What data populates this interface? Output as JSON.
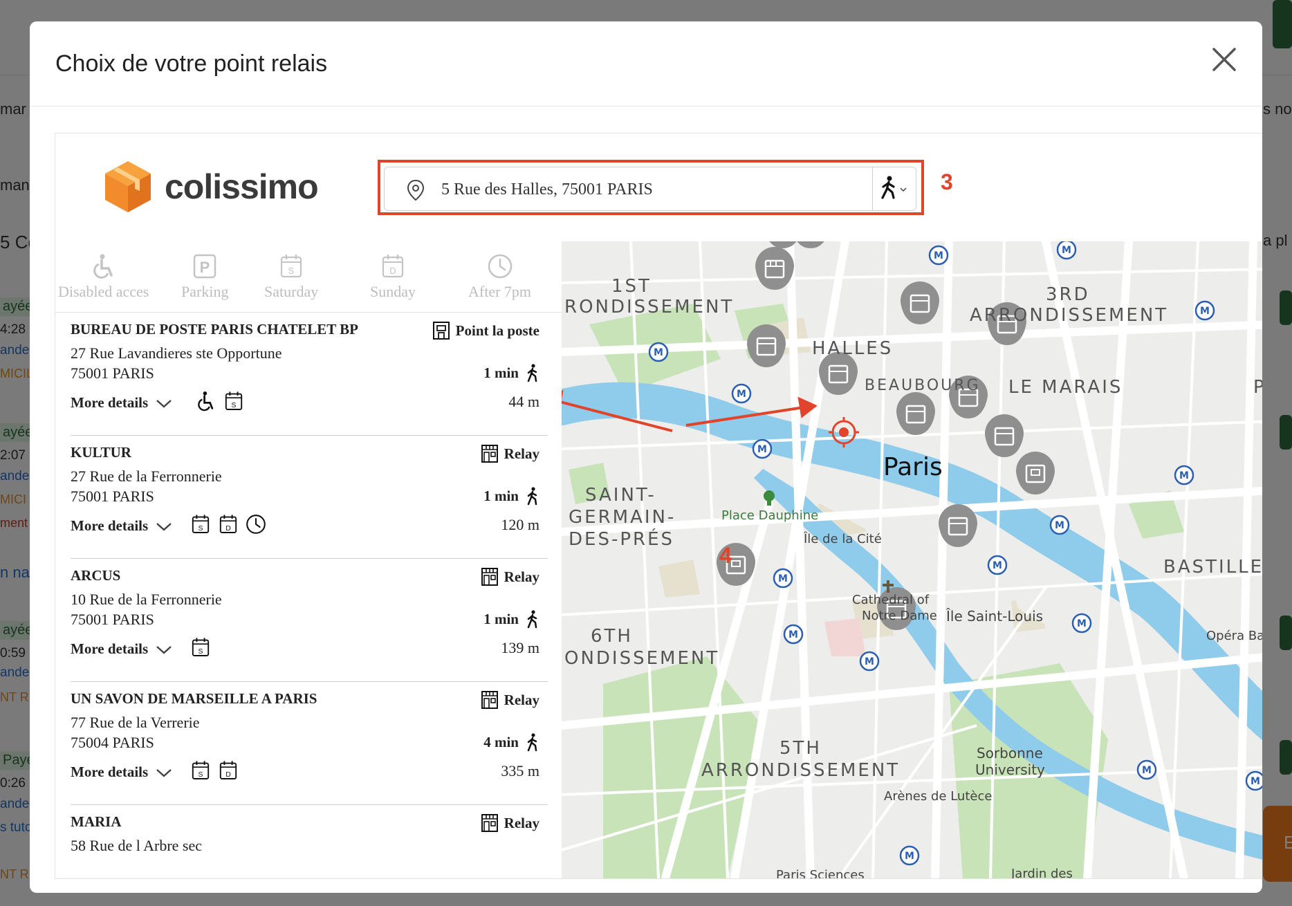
{
  "background": {
    "fragments": [
      "mar",
      "man",
      "5 Co",
      "ayée",
      "4:28",
      "ande",
      "MICIL",
      "ayée",
      "2:07",
      "ande",
      "MICI",
      "ment",
      "n nat",
      "ayée",
      "0:59",
      "ande",
      "NT RE",
      "Payée",
      "0:26",
      "ande",
      "s tuto",
      "NT RE",
      "s no",
      "a pl",
      "E"
    ]
  },
  "modal": {
    "title": "Choix de votre point relais",
    "close_label": "×"
  },
  "widget": {
    "brand": "colissimo",
    "search": {
      "value": "5 Rue des Halles, 75001 PARIS",
      "mode": "walking"
    },
    "annotations": {
      "search": "3",
      "arrow": "4"
    },
    "filters": [
      {
        "label": "Disabled acces",
        "icon": "wheelchair-icon"
      },
      {
        "label": "Parking",
        "icon": "parking-icon"
      },
      {
        "label": "Saturday",
        "icon": "calendar-s-icon"
      },
      {
        "label": "Sunday",
        "icon": "calendar-d-icon"
      },
      {
        "label": "After 7pm",
        "icon": "clock-icon"
      }
    ],
    "items": [
      {
        "name": "BUREAU DE POSTE PARIS CHATELET BP",
        "type": "Point la poste",
        "street": "27 Rue Lavandieres ste Opportune",
        "city": "75001 PARIS",
        "time": "1 min",
        "distance": "44 m",
        "more": "More details",
        "services": [
          "wheelchair",
          "calendar-s"
        ]
      },
      {
        "name": "KULTUR",
        "type": "Relay",
        "street": "27 Rue de la Ferronnerie",
        "city": "75001 PARIS",
        "time": "1 min",
        "distance": "120 m",
        "more": "More details",
        "services": [
          "calendar-s",
          "calendar-d",
          "clock"
        ]
      },
      {
        "name": "ARCUS",
        "type": "Relay",
        "street": "10 Rue de la Ferronnerie",
        "city": "75001 PARIS",
        "time": "1 min",
        "distance": "139 m",
        "more": "More details",
        "services": [
          "calendar-s"
        ]
      },
      {
        "name": "UN SAVON DE MARSEILLE A PARIS",
        "type": "Relay",
        "street": "77 Rue de la Verrerie",
        "city": "75004 PARIS",
        "time": "4 min",
        "distance": "335 m",
        "more": "More details",
        "services": [
          "calendar-s",
          "calendar-d"
        ]
      },
      {
        "name": "MARIA",
        "type": "Relay",
        "street": "58 Rue de l Arbre sec",
        "city": "",
        "time": "",
        "distance": "",
        "more": "",
        "services": []
      }
    ],
    "map": {
      "labels": {
        "arr1a": "1ST",
        "arr1b": "RONDISSEMENT",
        "arr3a": "3RD",
        "arr3b": "ARRONDISSEMENT",
        "halles": "HALLES",
        "beaubourg": "BEAUBOURG",
        "marais": "LE MARAIS",
        "po": "PO",
        "paris": "Paris",
        "sg1": "SAINT-",
        "sg2": "GERMAIN-",
        "sg3": "DES-PRÉS",
        "dauphine": "Place Dauphine",
        "cite": "Île de la Cité",
        "cathedral1": "Cathedral of",
        "cathedral2": "Notre Dame",
        "stlouis": "Île Saint-Louis",
        "bastille": "BASTILLE",
        "opera": "Opéra Bastill",
        "arr6a": "6TH",
        "arr6b": "ONDISSEMENT",
        "arr5a": "5TH",
        "arr5b": "ARRONDISSEMENT",
        "sorbonne1": "Sorbonne",
        "sorbonne2": "University",
        "arenes": "Arènes de Lutèce",
        "sciences": "Paris Sciences",
        "jardin": "Jardin des"
      }
    }
  },
  "colors": {
    "accent": "#e0442b",
    "brand_orange": "#f28b2c",
    "river": "#8fcbea",
    "park": "#c5e0b4",
    "pin": "#8f8f8f"
  }
}
